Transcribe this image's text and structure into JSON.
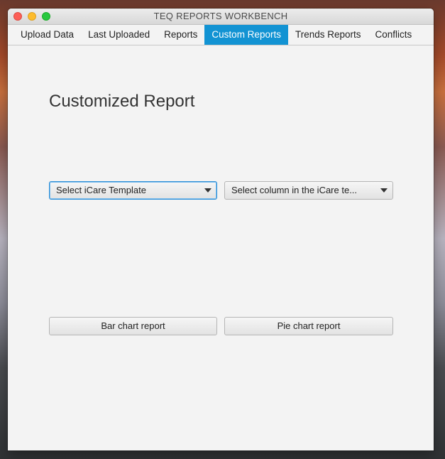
{
  "window": {
    "title": "TEQ REPORTS WORKBENCH"
  },
  "tabs": [
    {
      "label": "Upload Data"
    },
    {
      "label": "Last Uploaded"
    },
    {
      "label": "Reports"
    },
    {
      "label": "Custom Reports",
      "active": true
    },
    {
      "label": "Trends Reports"
    },
    {
      "label": "Conflicts"
    }
  ],
  "main": {
    "heading": "Customized Report",
    "template_select": {
      "value": "Select iCare Template"
    },
    "column_select": {
      "value": "Select column in the iCare te..."
    },
    "bar_button": "Bar chart report",
    "pie_button": "Pie chart report"
  },
  "colors": {
    "accent": "#1293d3"
  }
}
